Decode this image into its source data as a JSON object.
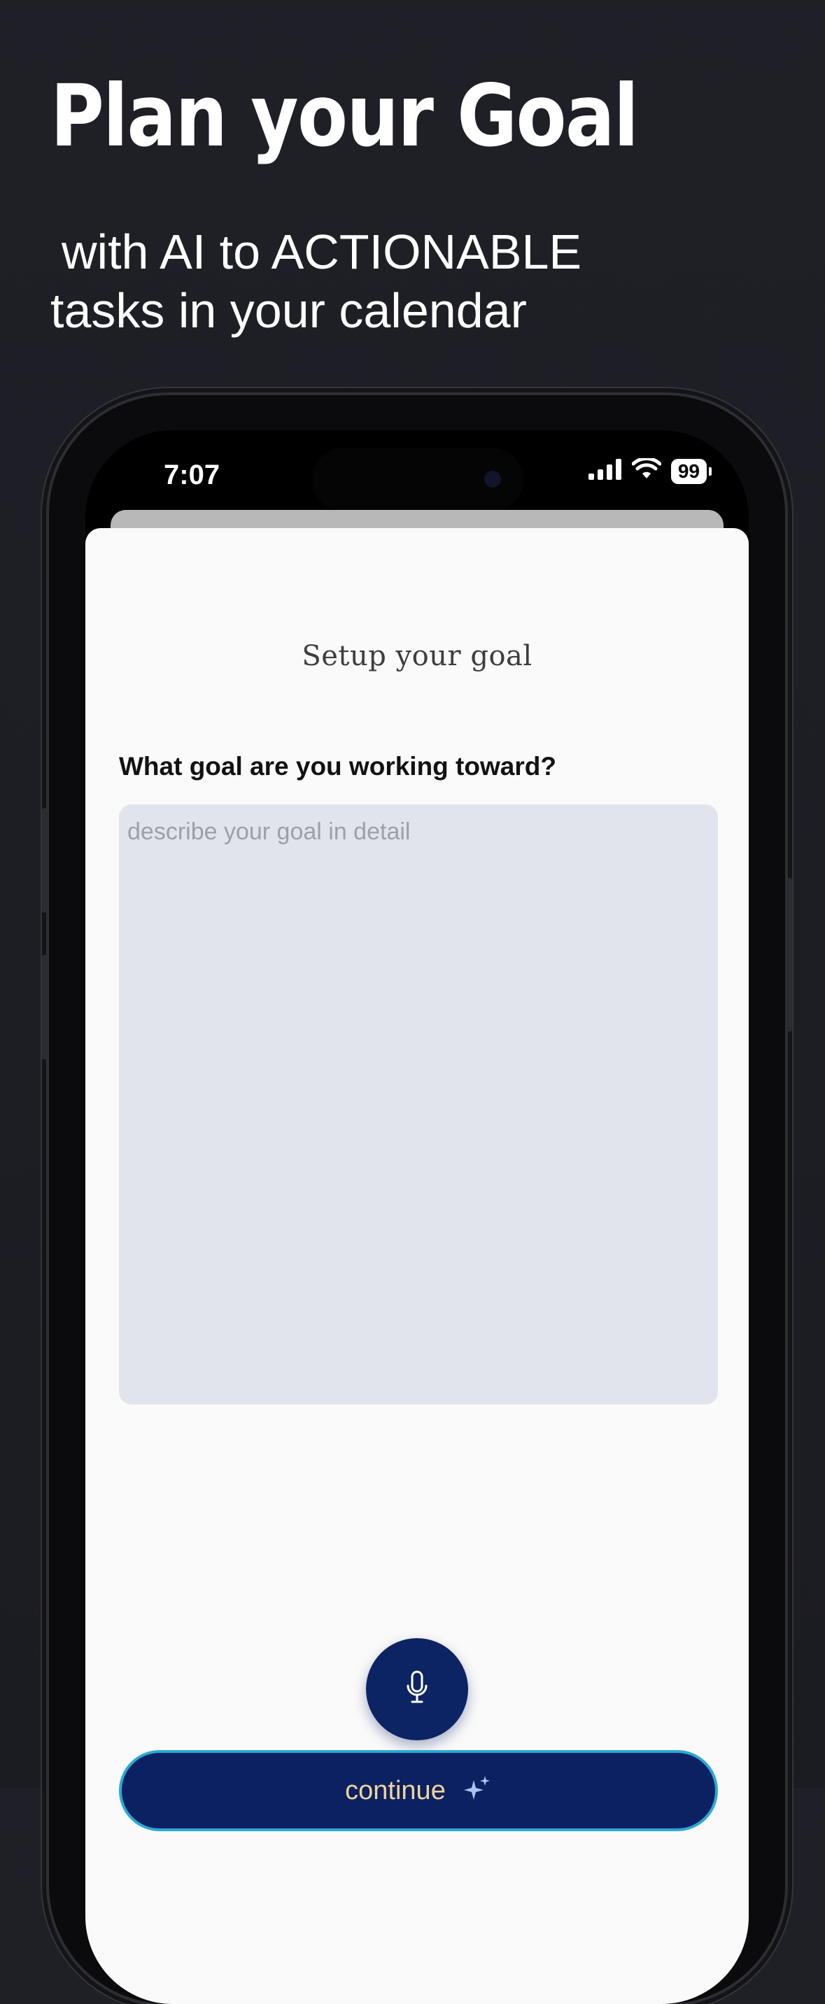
{
  "hero": {
    "title": "Plan your Goal",
    "subtitle_line1": "with AI to ACTIONABLE",
    "subtitle_line2": "tasks in your calendar"
  },
  "status_bar": {
    "time": "7:07",
    "battery": "99",
    "icons": [
      "cellular-signal-icon",
      "wifi-icon",
      "battery-icon"
    ]
  },
  "sheet": {
    "title": "Setup your goal",
    "question": "What goal are you working toward?",
    "goal_input": {
      "placeholder": "describe your goal in detail",
      "value": ""
    },
    "mic_icon": "microphone-icon",
    "continue_label": "continue",
    "continue_icon": "sparkles-icon"
  },
  "colors": {
    "background": "#1d1e24",
    "sheet": "#fafafa",
    "input": "#e1e4ec",
    "primary": "#0b2161",
    "button_border": "#2aa9d6",
    "button_text": "#f3d39a"
  }
}
